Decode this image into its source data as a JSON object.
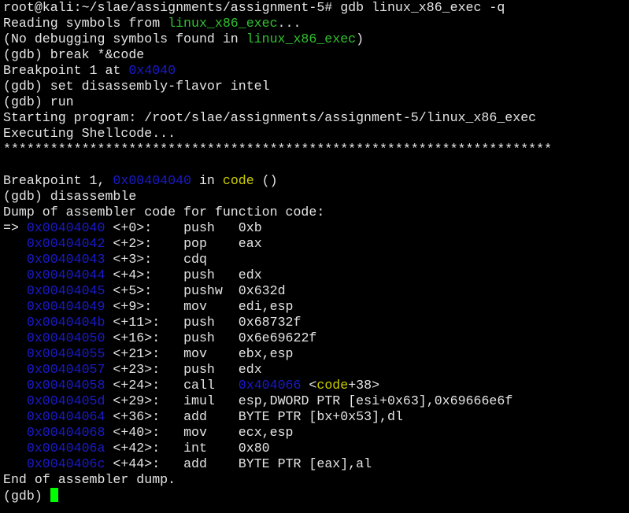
{
  "prompt": "root@kali:~/slae/assignments/assignment-5# ",
  "command": "gdb linux_x86_exec -q",
  "reading_pre": "Reading symbols from ",
  "filename": "linux_x86_exec",
  "reading_post": "...",
  "nodebug_pre": "(No debugging symbols found in ",
  "nodebug_post": ")",
  "gdb_prompt": "(gdb) ",
  "cmd_break": "break *&code",
  "bp_text": "Breakpoint 1 at ",
  "bp_addr": "0x4040",
  "cmd_flavor": "set disassembly-flavor intel",
  "cmd_run": "run",
  "starting": "Starting program: /root/slae/assignments/assignment-5/linux_x86_exec",
  "executing": "Executing Shellcode...",
  "stars": "**********************************************************************",
  "bp_hit_pre": "Breakpoint 1, ",
  "bp_hit_addr": "0x00404040",
  "bp_hit_in": " in ",
  "bp_hit_func": "code",
  "bp_hit_post": " ()",
  "cmd_disas": "disassemble",
  "dump_header": "Dump of assembler code for function code:",
  "arrow": "=> ",
  "dump_end": "End of assembler dump.",
  "disasm": [
    {
      "addr": "0x00404040",
      "off": "<+0>:",
      "mn": "push",
      "op": "0xb"
    },
    {
      "addr": "0x00404042",
      "off": "<+2>:",
      "mn": "pop",
      "op": "eax"
    },
    {
      "addr": "0x00404043",
      "off": "<+3>:",
      "mn": "cdq",
      "op": ""
    },
    {
      "addr": "0x00404044",
      "off": "<+4>:",
      "mn": "push",
      "op": "edx"
    },
    {
      "addr": "0x00404045",
      "off": "<+5>:",
      "mn": "pushw",
      "op": "0x632d"
    },
    {
      "addr": "0x00404049",
      "off": "<+9>:",
      "mn": "mov",
      "op": "edi,esp"
    },
    {
      "addr": "0x0040404b",
      "off": "<+11>:",
      "mn": "push",
      "op": "0x68732f"
    },
    {
      "addr": "0x00404050",
      "off": "<+16>:",
      "mn": "push",
      "op": "0x6e69622f"
    },
    {
      "addr": "0x00404055",
      "off": "<+21>:",
      "mn": "mov",
      "op": "ebx,esp"
    },
    {
      "addr": "0x00404057",
      "off": "<+23>:",
      "mn": "push",
      "op": "edx"
    },
    {
      "addr": "0x00404058",
      "off": "<+24>:",
      "mn": "call",
      "op": "",
      "target": "0x404066",
      "sym_open": " <",
      "sym": "code",
      "sym_close": "+38>"
    },
    {
      "addr": "0x0040405d",
      "off": "<+29>:",
      "mn": "imul",
      "op": "esp,DWORD PTR [esi+0x63],0x69666e6f"
    },
    {
      "addr": "0x00404064",
      "off": "<+36>:",
      "mn": "add",
      "op": "BYTE PTR [bx+0x53],dl"
    },
    {
      "addr": "0x00404068",
      "off": "<+40>:",
      "mn": "mov",
      "op": "ecx,esp"
    },
    {
      "addr": "0x0040406a",
      "off": "<+42>:",
      "mn": "int",
      "op": "0x80"
    },
    {
      "addr": "0x0040406c",
      "off": "<+44>:",
      "mn": "add",
      "op": "BYTE PTR [eax],al"
    }
  ],
  "colors": {
    "background": "#000000",
    "text": "#e5e5e5",
    "filename": "#2fc22f",
    "address": "#1a1acc",
    "symbol": "#cdcd00",
    "cursor": "#00ff00"
  }
}
